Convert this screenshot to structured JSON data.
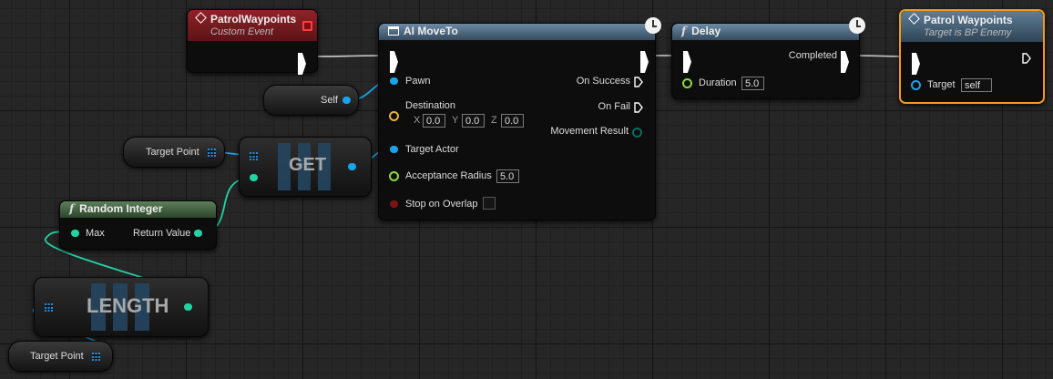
{
  "custom_event": {
    "title": "PatrolWaypoints",
    "subtitle": "Custom Event"
  },
  "self_node": {
    "label": "Self"
  },
  "target_point_top": {
    "label": "Target Point"
  },
  "target_point_bottom": {
    "label": "Target Point"
  },
  "get_node": {
    "label": "GET"
  },
  "length_node": {
    "label": "LENGTH"
  },
  "random_integer": {
    "title": "Random Integer",
    "max_label": "Max",
    "return_label": "Return Value"
  },
  "ai_moveto": {
    "title": "AI MoveTo",
    "pawn": "Pawn",
    "destination": "Destination",
    "x_label": "X",
    "x_value": "0.0",
    "y_label": "Y",
    "y_value": "0.0",
    "z_label": "Z",
    "z_value": "0.0",
    "target_actor": "Target Actor",
    "acceptance_radius": "Acceptance Radius",
    "acceptance_value": "5.0",
    "stop_on_overlap": "Stop on Overlap",
    "on_success": "On Success",
    "on_fail": "On Fail",
    "movement_result": "Movement Result"
  },
  "delay": {
    "title": "Delay",
    "completed": "Completed",
    "duration": "Duration",
    "duration_value": "5.0"
  },
  "patrol_waypoints": {
    "title": "Patrol Waypoints",
    "subtitle": "Target is BP Enemy",
    "target": "Target",
    "target_value": "self"
  },
  "colors": {
    "exec": "#ffffff",
    "object": "#1aa3e8",
    "vector": "#e3b33c",
    "integer": "#22d3a6",
    "float": "#8ed840",
    "bool": "#8a1a1a",
    "enum": "#0b6a62",
    "selected": "#f39a1c"
  },
  "icons": {
    "event": "diamond-icon",
    "function": "function-icon",
    "latent": "clock-icon",
    "array": "array-grid-icon"
  }
}
